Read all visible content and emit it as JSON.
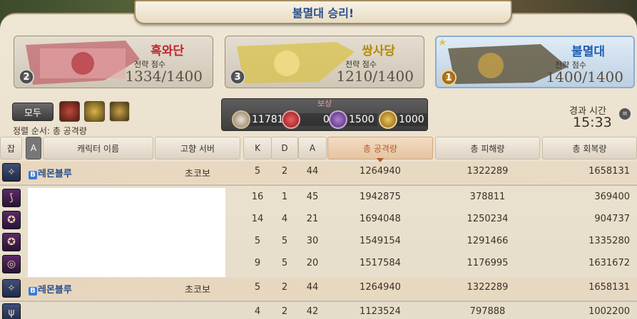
{
  "banner": {
    "title": "불멸대 승리!"
  },
  "teams": [
    {
      "name": "흑와단",
      "label": "전략 점수",
      "score": "1334/1400",
      "rank": "2",
      "color": "#c0242a"
    },
    {
      "name": "쌍사당",
      "label": "전략 점수",
      "score": "1210/1400",
      "rank": "3",
      "color": "#b28a00"
    },
    {
      "name": "불멸대",
      "label": "전략 점수",
      "score": "1400/1400",
      "rank": "1",
      "color": "#1f5fb0"
    }
  ],
  "filter": {
    "all_label": "모두",
    "sort_text": "정렬 순서: 총 공격량"
  },
  "reward": {
    "label": "보상",
    "items": [
      {
        "icon": "wolf-mark-icon",
        "value": "1178100"
      },
      {
        "icon": "red-token-icon",
        "value": "0"
      },
      {
        "icon": "purple-token-icon",
        "value": "1500"
      },
      {
        "icon": "gold-medal-icon",
        "value": "1000"
      }
    ]
  },
  "elapsed": {
    "label": "경과 시간",
    "time": "15:33"
  },
  "table": {
    "headers": [
      "잡",
      "A",
      "캐릭터 이름",
      "고향 서버",
      "K",
      "D",
      "A",
      "총 공격량",
      "총 피해량",
      "총 회복량"
    ],
    "rows": [
      {
        "job": "✧",
        "name": "레몬블루",
        "server": "초코보",
        "k": "5",
        "d": "2",
        "a": "44",
        "dmg": "1264940",
        "taken": "1322289",
        "heal": "1658131",
        "highlight": true
      },
      {
        "job": "⟆",
        "name": "",
        "server": "",
        "k": "16",
        "d": "1",
        "a": "45",
        "dmg": "1942875",
        "taken": "378811",
        "heal": "369400",
        "highlight": false
      },
      {
        "job": "✪",
        "name": "",
        "server": "",
        "k": "14",
        "d": "4",
        "a": "21",
        "dmg": "1694048",
        "taken": "1250234",
        "heal": "904737",
        "highlight": false
      },
      {
        "job": "✪",
        "name": "",
        "server": "",
        "k": "5",
        "d": "5",
        "a": "30",
        "dmg": "1549154",
        "taken": "1291466",
        "heal": "1335280",
        "highlight": false
      },
      {
        "job": "◎",
        "name": "",
        "server": "",
        "k": "9",
        "d": "5",
        "a": "20",
        "dmg": "1517584",
        "taken": "1176995",
        "heal": "1631672",
        "highlight": false
      },
      {
        "job": "✧",
        "name": "레몬블루",
        "server": "초코보",
        "k": "5",
        "d": "2",
        "a": "44",
        "dmg": "1264940",
        "taken": "1322289",
        "heal": "1658131",
        "highlight": true
      },
      {
        "job": "ψ",
        "name": "",
        "server": "",
        "k": "4",
        "d": "2",
        "a": "42",
        "dmg": "1123524",
        "taken": "797888",
        "heal": "1002200",
        "highlight": false
      }
    ]
  }
}
